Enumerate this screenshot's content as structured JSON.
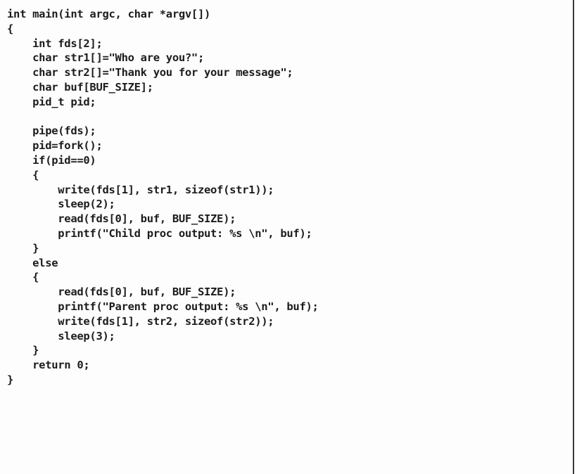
{
  "code_lines": [
    "int main(int argc, char *argv[])",
    "{",
    "    int fds[2];",
    "    char str1[]=\"Who are you?\";",
    "    char str2[]=\"Thank you for your message\";",
    "    char buf[BUF_SIZE];",
    "    pid_t pid;",
    "",
    "    pipe(fds);",
    "    pid=fork();",
    "    if(pid==0)",
    "    {",
    "        write(fds[1], str1, sizeof(str1));",
    "        sleep(2);",
    "        read(fds[0], buf, BUF_SIZE);",
    "        printf(\"Child proc output: %s \\n\", buf);",
    "    }",
    "    else",
    "    {",
    "        read(fds[0], buf, BUF_SIZE);",
    "        printf(\"Parent proc output: %s \\n\", buf);",
    "        write(fds[1], str2, sizeof(str2));",
    "        sleep(3);",
    "    }",
    "    return 0;",
    "}"
  ]
}
